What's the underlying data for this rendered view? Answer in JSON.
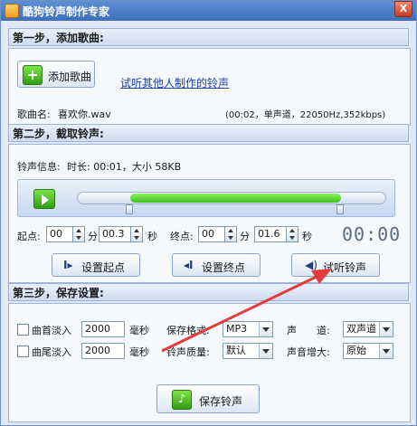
{
  "window": {
    "title": "酷狗铃声制作专家",
    "close_label": "X"
  },
  "step1": {
    "heading": "第一步，添加歌曲:",
    "add_song_label": "添加歌曲",
    "listen_link": "试听其他人制作的铃声",
    "song_name_label": "歌曲名:",
    "song_name": "喜欢你.wav",
    "song_info": "(00:02，单声道，22050Hz,352kbps)"
  },
  "step2": {
    "heading": "第二步，截取铃声:",
    "ringtone_info_label": "铃声信息:",
    "ringtone_info": "时长: 00:01，大小 58KB",
    "start_label": "起点:",
    "start_min": "00",
    "min_unit": "分",
    "start_sec": "00.3",
    "sec_unit": "秒",
    "end_label": "终点:",
    "end_min": "00",
    "end_sec": "01.6",
    "time_display": "00:00",
    "set_start_label": "设置起点",
    "set_end_label": "设置终点",
    "preview_label": "试听铃声",
    "selection_start": 0.17,
    "selection_end": 0.85
  },
  "step3": {
    "heading": "第三步，保存设置:",
    "fade_in_label": "曲首淡入",
    "fade_in_value": "2000",
    "fade_out_label": "曲尾淡入",
    "fade_out_value": "2000",
    "ms_unit": "毫秒",
    "format_label": "保存格式:",
    "format_value": "MP3",
    "quality_label": "铃声质量:",
    "quality_value": "默认",
    "channel_label": "声　　道:",
    "channel_value": "双声道",
    "volume_label": "声音增大:",
    "volume_value": "原始",
    "save_label": "保存铃声"
  },
  "colors": {
    "accent_green": "#3fbf1f",
    "arrow_red": "#e43b3b",
    "titlebar": "#4a7cc7"
  }
}
